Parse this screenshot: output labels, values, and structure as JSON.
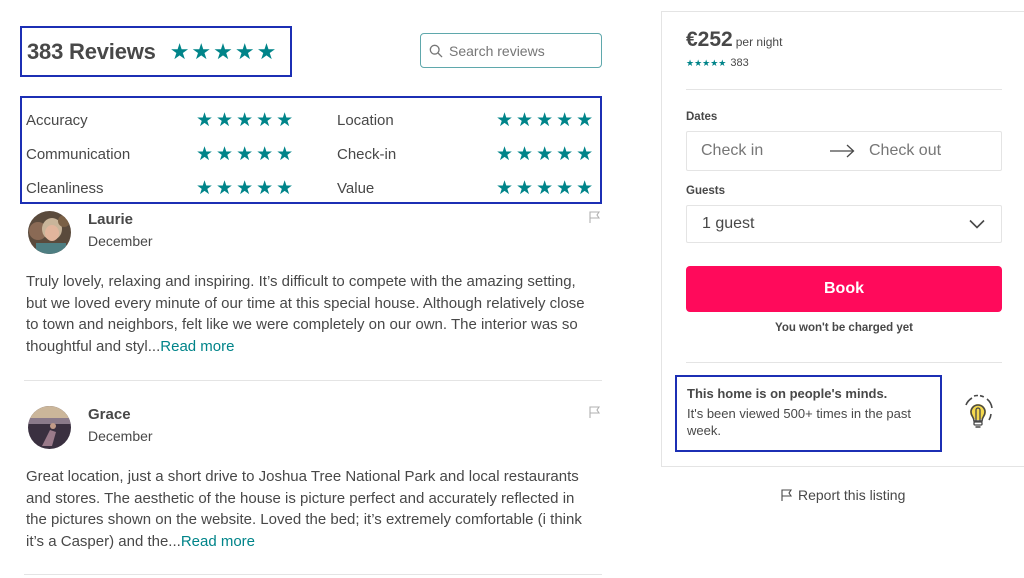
{
  "reviews_header": {
    "title": "383 Reviews",
    "overall_rating": 5,
    "stars": "★★★★★"
  },
  "search": {
    "placeholder": "Search reviews",
    "value": "",
    "icon": "search-icon"
  },
  "category_ratings": [
    {
      "label": "Accuracy",
      "rating": 5,
      "stars": "★★★★★"
    },
    {
      "label": "Communication",
      "rating": 5,
      "stars": "★★★★★"
    },
    {
      "label": "Cleanliness",
      "rating": 5,
      "stars": "★★★★★"
    },
    {
      "label": "Location",
      "rating": 5,
      "stars": "★★★★★"
    },
    {
      "label": "Check-in",
      "rating": 5,
      "stars": "★★★★★"
    },
    {
      "label": "Value",
      "rating": 5,
      "stars": "★★★★★"
    }
  ],
  "reviews": [
    {
      "name": "Laurie",
      "date": "December",
      "text": "Truly lovely, relaxing and inspiring. It’s difficult to compete with the amazing setting, but we loved every minute of our time at this special house. Although relatively close to town and neighbors, felt like we were completely on our own. The interior was so thoughtful and styl...",
      "read_more": "Read more",
      "flag_icon": "flag-icon"
    },
    {
      "name": "Grace",
      "date": "December",
      "text": "Great location, just a short drive to Joshua Tree National Park and local restaurants and stores. The aesthetic of the house is picture perfect and accurately reflected in the pictures shown on the website. Loved the bed; it’s extremely comfortable (i think it’s a Casper) and the...",
      "read_more": "Read more",
      "flag_icon": "flag-icon"
    }
  ],
  "booking": {
    "price": "€252",
    "price_unit": "per night",
    "mini_stars": "★★★★★",
    "review_count": "383",
    "dates_label": "Dates",
    "check_in": "Check in",
    "check_out": "Check out",
    "guests_label": "Guests",
    "guests_value": "1 guest",
    "book_label": "Book",
    "no_charge_note": "You won't be charged yet",
    "accent_color": "#ff0a5b"
  },
  "popularity": {
    "title": "This home is on people's minds.",
    "text": "It's been viewed 500+ times in the past week.",
    "icon": "lightbulb-icon"
  },
  "report": {
    "label": "Report this listing",
    "icon": "flag-icon"
  },
  "colors": {
    "star": "#008489",
    "text": "#484848",
    "highlight_border": "#1c2fb4",
    "link": "#008489"
  }
}
